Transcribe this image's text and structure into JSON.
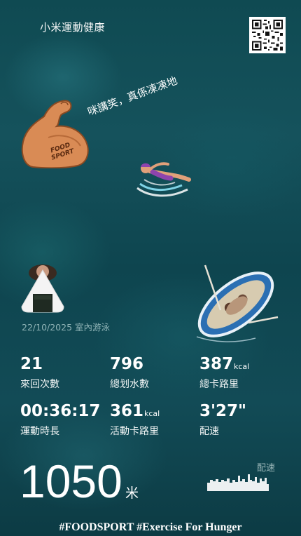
{
  "header": {
    "app_title": "小米運動健康",
    "qr_icon": "qr-code-icon"
  },
  "slogan": "咪講笑，真係凍凍地",
  "stickers": {
    "arm_icon": "flexed-biceps-foodsport-icon",
    "arm_text": "FOOD SPORT",
    "swimmer_icon": "swimmer-icon",
    "riceball_icon": "rice-ball-icon",
    "boat_icon": "rowboat-icon"
  },
  "workout": {
    "date_type": "22/10/2025 室內游泳"
  },
  "stats": [
    {
      "value": "21",
      "unit": "",
      "label": "來回次數"
    },
    {
      "value": "796",
      "unit": "",
      "label": "總划水數"
    },
    {
      "value": "387",
      "unit": "kcal",
      "label": "總卡路里"
    },
    {
      "value": "00:36:17",
      "unit": "",
      "label": "運動時長"
    },
    {
      "value": "361",
      "unit": "kcal",
      "label": "活動卡路里"
    },
    {
      "value": "3'27\"",
      "unit": "",
      "label": "配速"
    }
  ],
  "distance": {
    "value": "1050",
    "unit": "米"
  },
  "pace_chart": {
    "label": "配速",
    "color": "#ffffff"
  },
  "footer": "#FOODSPORT #Exercise For Hunger",
  "colors": {
    "background": "#0f4a52",
    "muted_text": "#8fb3b6"
  }
}
